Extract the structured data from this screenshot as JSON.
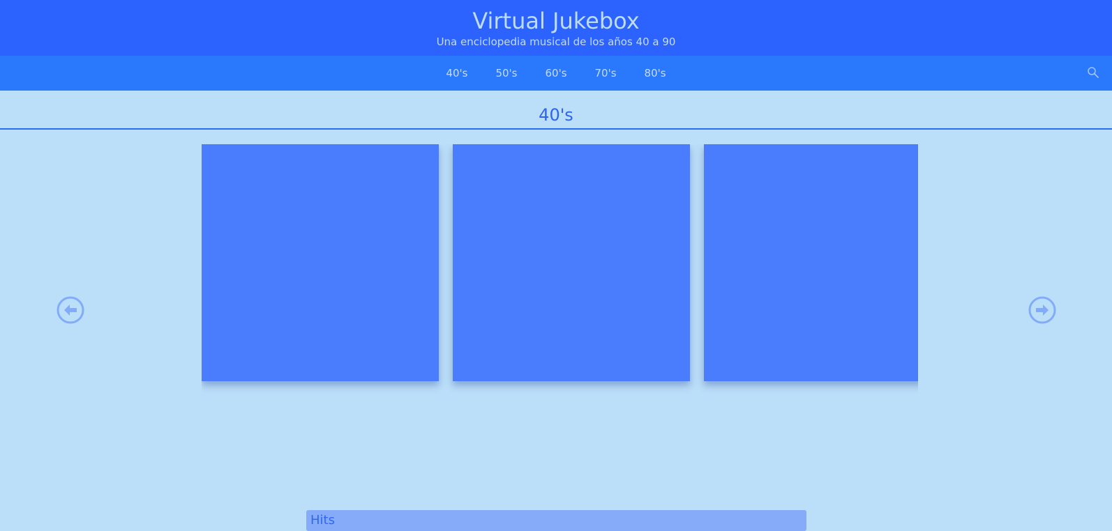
{
  "header": {
    "title": "Virtual Jukebox",
    "subtitle": "Una enciclopedia musical de los años 40 a 90"
  },
  "nav": {
    "items": [
      "40's",
      "50's",
      "60's",
      "70's",
      "80's"
    ],
    "search_icon": "search-icon"
  },
  "section": {
    "title": "40's"
  },
  "carousel": {
    "prev_icon": "arrow-left-circle-icon",
    "next_icon": "arrow-right-circle-icon",
    "card_color": "#4a7dfd"
  },
  "hits": {
    "label": "Hits"
  },
  "colors": {
    "header_bg": "#2c62fd",
    "nav_bg": "#2a78fc",
    "page_bg": "#bbdef9",
    "accent": "#2d63f0"
  }
}
